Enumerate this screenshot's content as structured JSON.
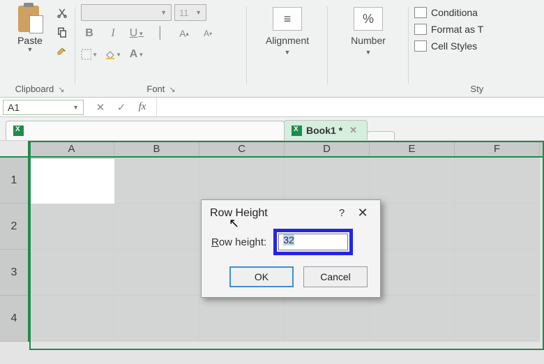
{
  "ribbon": {
    "clipboard": {
      "paste_label": "Paste",
      "group_label": "Clipboard"
    },
    "font": {
      "font_size_placeholder": "11",
      "bold": "B",
      "italic": "I",
      "underline": "U",
      "grow": "A",
      "shrink": "A",
      "group_label": "Font"
    },
    "alignment": {
      "label": "Alignment"
    },
    "number": {
      "symbol": "%",
      "label": "Number"
    },
    "styles": {
      "conditional": "Conditiona",
      "format_table": "Format as T",
      "cell_styles": "Cell Styles",
      "group_label": "Sty"
    }
  },
  "name_box": {
    "value": "A1"
  },
  "formula_bar": {
    "cancel": "✕",
    "commit": "✓",
    "fx": "fx"
  },
  "workbook_tabs": {
    "active": "Book1 *"
  },
  "grid": {
    "cols": [
      "A",
      "B",
      "C",
      "D",
      "E",
      "F"
    ],
    "rows": [
      "1",
      "2",
      "3",
      "4"
    ]
  },
  "dialog": {
    "title": "Row Height",
    "help": "?",
    "close": "✕",
    "label_underlined": "R",
    "label_rest": "ow height:",
    "value": "32",
    "ok": "OK",
    "cancel": "Cancel"
  }
}
